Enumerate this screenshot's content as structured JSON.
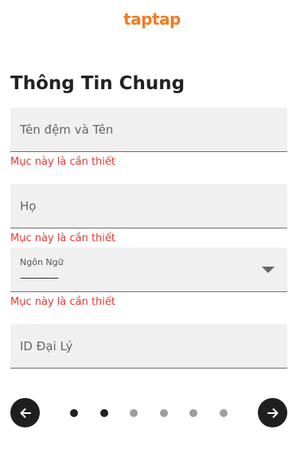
{
  "brand": {
    "logo_text": "taptap",
    "logo_color": "#f47b20"
  },
  "page": {
    "title": "Thông Tin Chung"
  },
  "form": {
    "first_name": {
      "placeholder": "Tên đệm và Tên",
      "error": "Mục này là cần thiết"
    },
    "last_name": {
      "placeholder": "Họ",
      "error": "Mục này là cần thiết"
    },
    "language": {
      "label": "Ngôn Ngữ",
      "value": "————",
      "error": "Mục này là cần thiết"
    },
    "agent_id": {
      "placeholder": "ID Đại Lý"
    }
  },
  "pagination": {
    "total_steps": 6,
    "active_steps": [
      1,
      2
    ],
    "prev_icon": "arrow-left-icon",
    "next_icon": "arrow-right-icon"
  },
  "colors": {
    "error": "#e53935",
    "field_bg": "#f0f0f0",
    "dark": "#1f1f1f",
    "inactive_dot": "#9e9e9e"
  }
}
